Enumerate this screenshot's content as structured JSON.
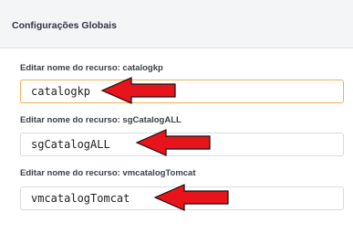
{
  "header": {
    "title": "Configurações Globais"
  },
  "fields": [
    {
      "label": "Editar nome do recurso: catalogkp",
      "value": "catalogkp"
    },
    {
      "label": "Editar nome do recurso: sgCatalogALL",
      "value": "sgCatalogALL"
    },
    {
      "label": "Editar nome do recurso: vmcatalogTomcat",
      "value": "vmcatalogTomcat"
    }
  ],
  "colors": {
    "focus_border": "#f0b256",
    "arrow": "#e8141c"
  },
  "icons": [
    "red-arrow-icon"
  ]
}
